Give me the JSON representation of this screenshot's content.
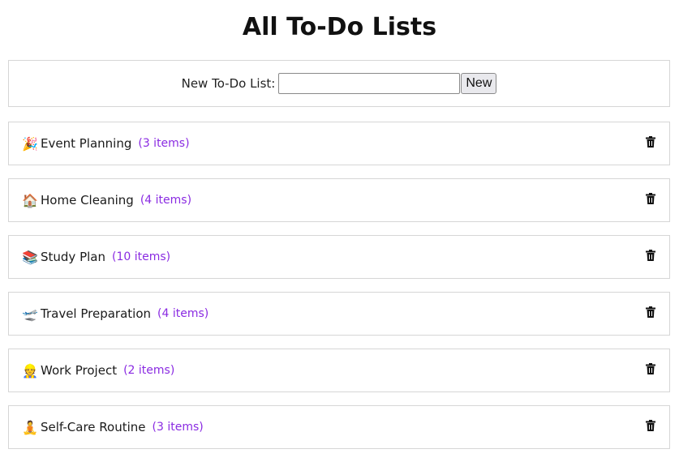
{
  "page": {
    "title": "All To-Do Lists"
  },
  "new_list": {
    "label": "New To-Do List:",
    "input_value": "",
    "input_placeholder": "",
    "button_label": "New"
  },
  "lists": [
    {
      "emoji": "🎉",
      "name": "Event Planning",
      "count": "(3 items)"
    },
    {
      "emoji": "🏠",
      "name": "Home Cleaning",
      "count": "(4 items)"
    },
    {
      "emoji": "📚",
      "name": "Study Plan",
      "count": "(10 items)"
    },
    {
      "emoji": "🛫",
      "name": "Travel Preparation",
      "count": "(4 items)"
    },
    {
      "emoji": "👷",
      "name": "Work Project",
      "count": "(2 items)"
    },
    {
      "emoji": "🧘",
      "name": "Self-Care Routine",
      "count": "(3 items)"
    }
  ],
  "icons": {
    "delete": "trash-icon"
  },
  "colors": {
    "item_count": "#8a2be2",
    "border": "#d6d6d6",
    "button_bg": "#e9e9ed"
  }
}
